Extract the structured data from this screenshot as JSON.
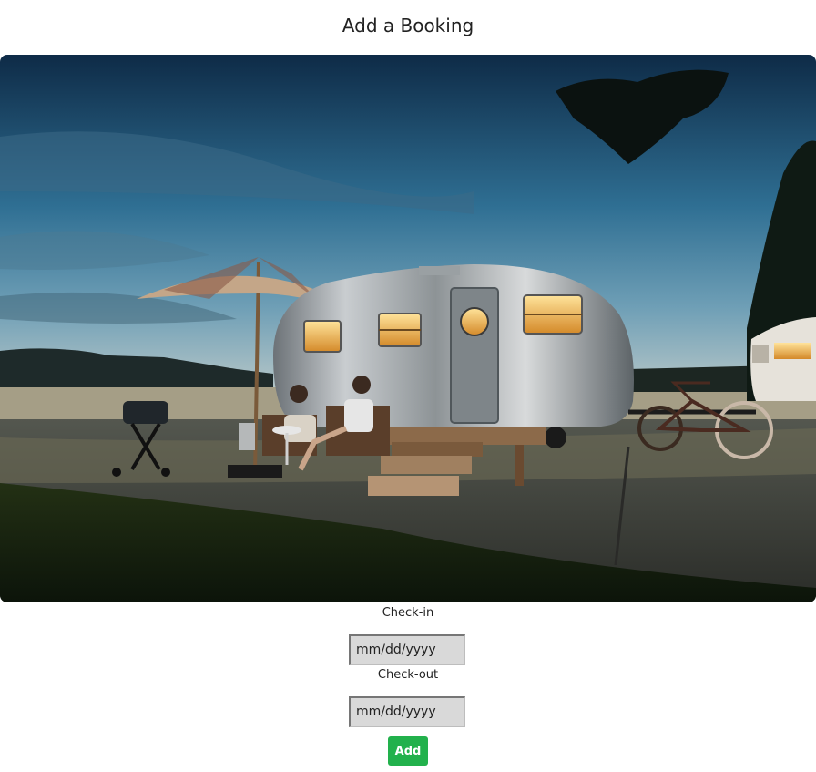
{
  "page": {
    "title": "Add a Booking"
  },
  "hero": {
    "subject": "vintage-trailer-campsite-photo"
  },
  "form": {
    "checkin_label": "Check-in",
    "checkin_placeholder": "mm/dd/yyyy",
    "checkout_label": "Check-out",
    "checkout_placeholder": "mm/dd/yyyy",
    "add_label": "Add"
  },
  "colors": {
    "add_button": "#22b14c",
    "input_background": "#d9d9d9"
  }
}
